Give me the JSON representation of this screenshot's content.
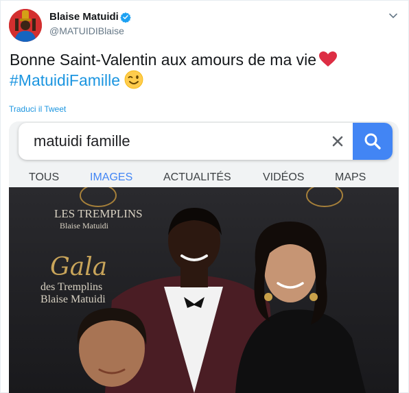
{
  "author": {
    "name": "Blaise Matuidi",
    "handle": "@MATUIDIBlaise"
  },
  "tweet": {
    "line1": "Bonne Saint-Valentin aux amours de ma vie",
    "hashtag": "#MatuidiFamille",
    "translate_label": "Traduci il Tweet"
  },
  "media": {
    "search_query": "matuidi famille",
    "tabs": [
      "TOUS",
      "IMAGES",
      "ACTUALITÉS",
      "VIDÉOS",
      "MAPS"
    ],
    "active_tab": "IMAGES",
    "backdrop": {
      "brand": "LES TREMPLINS",
      "sub": "Blaise Matuidi",
      "gala_script": "Gala",
      "gala_line2": "des Tremplins",
      "gala_line3": "Blaise Matuidi"
    }
  },
  "colors": {
    "link": "#1b95e0",
    "google_blue": "#4285f4",
    "verified": "#1da1f2",
    "heart": "#e0245e"
  }
}
